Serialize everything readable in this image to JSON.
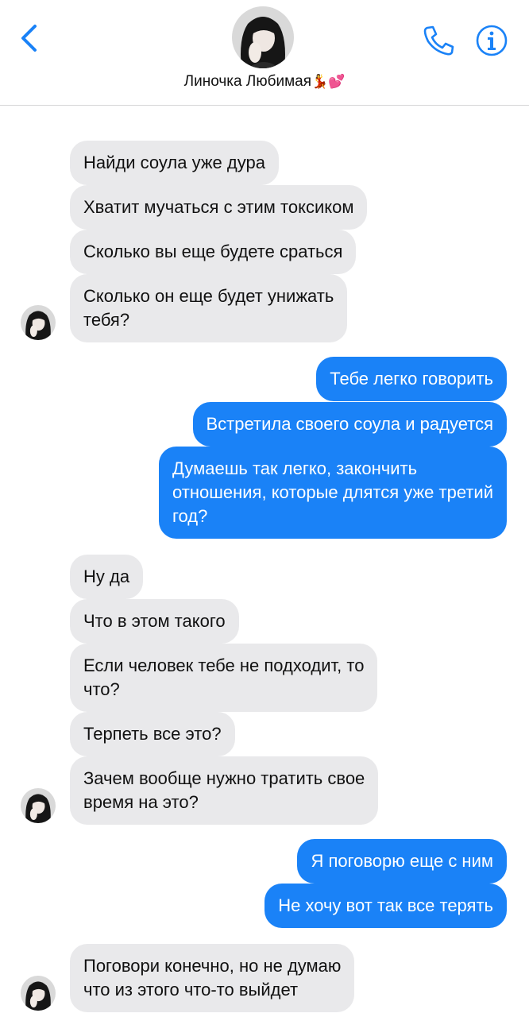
{
  "header": {
    "contact_name": "Линочка Любимая",
    "name_emoji": "💃💕",
    "back_icon": "chevron-left-icon",
    "call_icon": "phone-icon",
    "info_icon": "info-icon",
    "accent_color": "#1a82f7"
  },
  "messages": [
    {
      "dir": "in",
      "lines": [
        "Найди соула уже дура"
      ]
    },
    {
      "dir": "in",
      "lines": [
        "Хватит мучаться с этим токсиком"
      ]
    },
    {
      "dir": "in",
      "lines": [
        "Сколько вы еще будете сраться"
      ]
    },
    {
      "dir": "in",
      "lines": [
        "Сколько он еще будет унижать",
        "тебя?"
      ]
    },
    {
      "dir": "out",
      "lines": [
        "Тебе легко говорить"
      ]
    },
    {
      "dir": "out",
      "lines": [
        "Встретила своего соула и радуется"
      ]
    },
    {
      "dir": "out",
      "lines": [
        "Думаешь так легко, закончить",
        "отношения, которые длятся уже третий",
        "год?"
      ]
    },
    {
      "dir": "in",
      "lines": [
        "Ну да"
      ]
    },
    {
      "dir": "in",
      "lines": [
        "Что в этом такого"
      ]
    },
    {
      "dir": "in",
      "lines": [
        "Если человек тебе не подходит, то",
        "что?"
      ]
    },
    {
      "dir": "in",
      "lines": [
        "Терпеть все это?"
      ]
    },
    {
      "dir": "in",
      "lines": [
        "Зачем вообще нужно тратить свое",
        "время на это?"
      ]
    },
    {
      "dir": "out",
      "lines": [
        "Я поговорю еще с ним"
      ]
    },
    {
      "dir": "out",
      "lines": [
        "Не хочу вот так все терять"
      ]
    },
    {
      "dir": "in",
      "lines": [
        "Поговори конечно, но не думаю",
        "что из этого что-то выйдет"
      ]
    }
  ],
  "colors": {
    "incoming_bubble": "#e9e9eb",
    "outgoing_bubble": "#1a82f7"
  }
}
